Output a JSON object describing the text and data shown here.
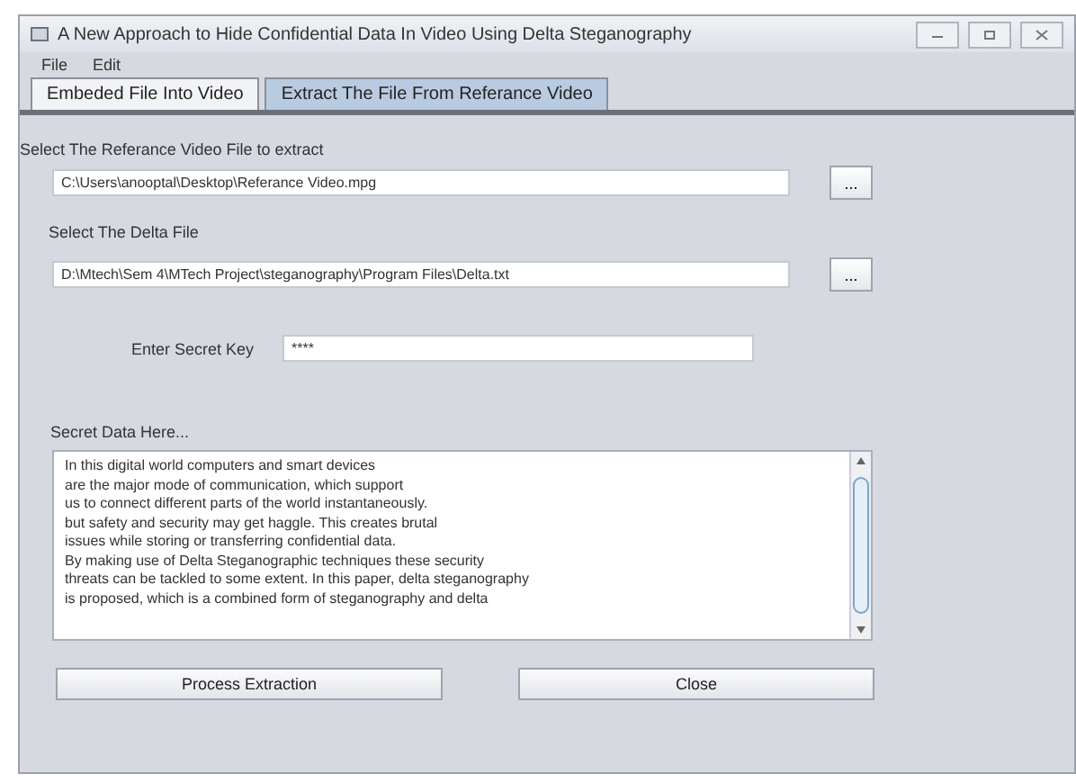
{
  "window": {
    "title": "A New Approach to Hide Confidential Data In Video Using Delta Steganography"
  },
  "menu": [
    "File",
    "Edit"
  ],
  "tabs": [
    {
      "label": "Embeded File Into Video",
      "selected": false
    },
    {
      "label": "Extract The File From Referance Video",
      "selected": true
    }
  ],
  "video_file": {
    "label": "Select The Referance Video File to extract",
    "value": "C:\\Users\\anooptal\\Desktop\\Referance Video.mpg",
    "browse": "..."
  },
  "delta_file": {
    "label": "Select The Delta File",
    "value": "D:\\Mtech\\Sem 4\\MTech Project\\steganography\\Program Files\\Delta.txt",
    "browse": "..."
  },
  "secret_key": {
    "label": "Enter Secret Key",
    "value": "****"
  },
  "secret_data": {
    "label": "Secret Data Here...",
    "lines": [
      "In this digital world computers and smart devices",
      "are the major mode of communication, which support",
      "us to connect different parts of the world instantaneously.",
      "but safety and security may get haggle. This creates brutal",
      "issues while storing or transferring confidential data.",
      "By making use of Delta Steganographic techniques these security",
      "threats can be tackled to some extent. In this paper, delta steganography",
      "is proposed, which is a combined form of steganography and delta"
    ]
  },
  "buttons": [
    "Process Extraction",
    "Close"
  ]
}
